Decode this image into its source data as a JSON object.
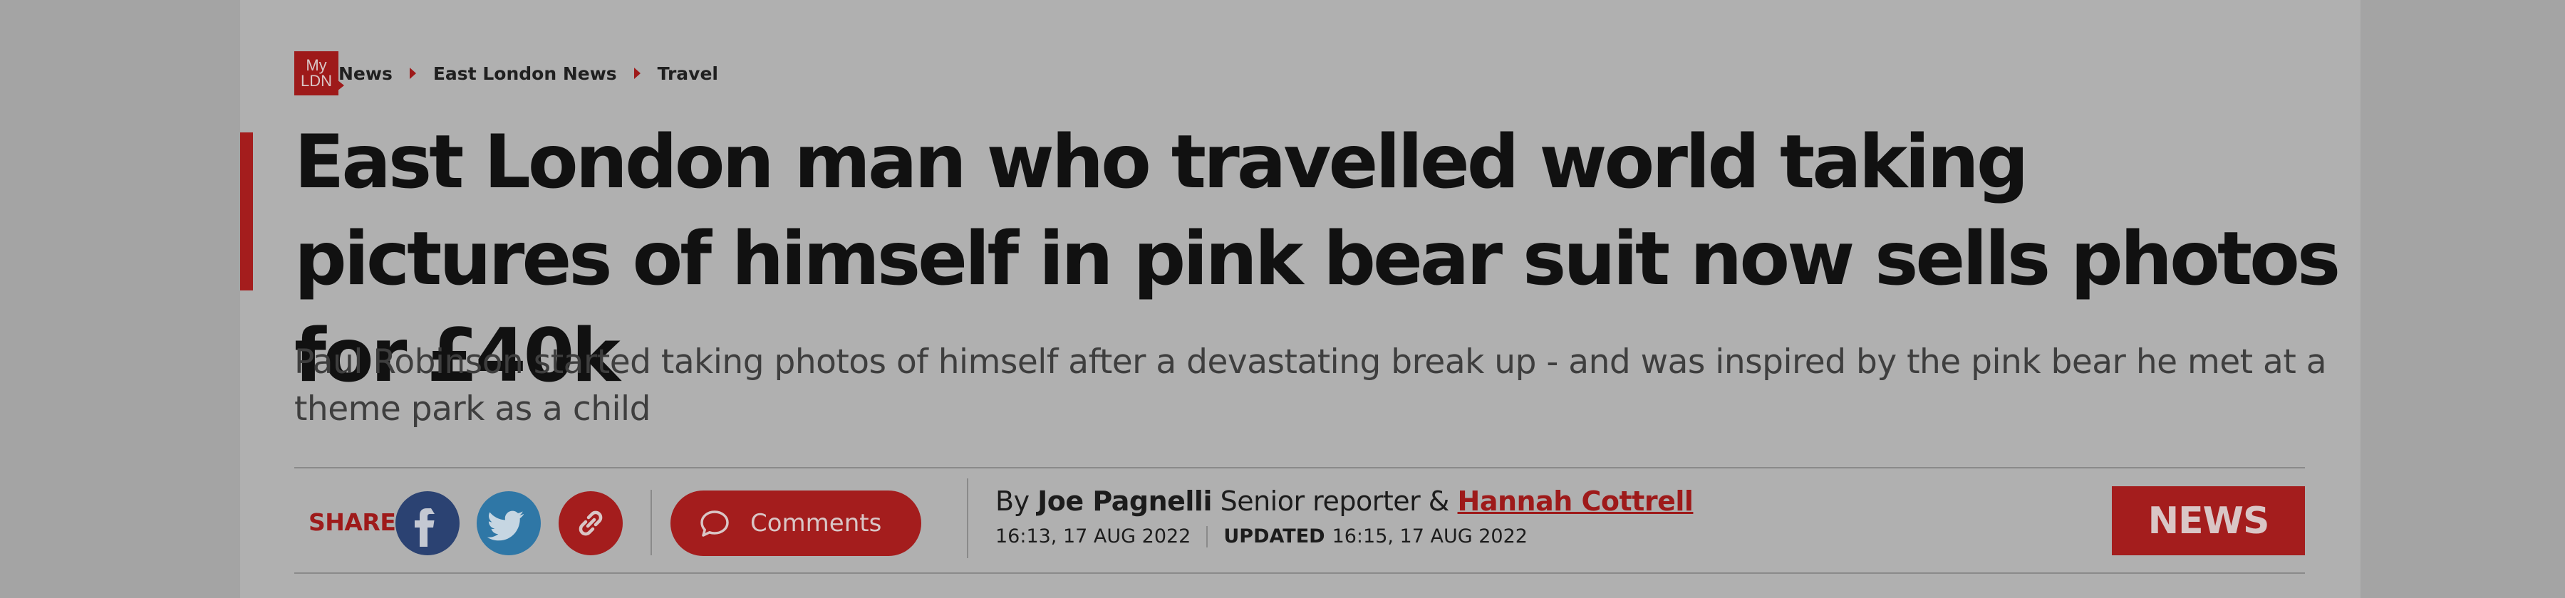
{
  "breadcrumb": {
    "logo_line1": "My",
    "logo_line2": "LDN",
    "items": [
      "News",
      "East London News",
      "Travel"
    ]
  },
  "article": {
    "headline": "East London man who travelled world taking pictures of himself in pink bear suit now sells photos for £40k",
    "standfirst": "Paul Robinson started taking photos of himself after a devastating break up - and was inspired by the pink bear he met at a theme park as a child"
  },
  "share": {
    "label": "SHARE",
    "buttons": [
      {
        "name": "facebook",
        "icon": "facebook-icon",
        "color": "#2b4272"
      },
      {
        "name": "twitter",
        "icon": "twitter-icon",
        "color": "#2f77a6"
      },
      {
        "name": "copy-link",
        "icon": "link-icon",
        "color": "#a41d1d"
      }
    ],
    "comments_label": "Comments"
  },
  "byline": {
    "by": "By",
    "author1": "Joe Pagnelli",
    "role": "Senior reporter &",
    "author2": "Hannah Cottrell",
    "published": "16:13, 17 AUG 2022",
    "updated_label": "UPDATED",
    "updated": "16:15, 17 AUG 2022"
  },
  "section_badge": "NEWS",
  "colors": {
    "accent": "#a41d1d",
    "facebook": "#2b4272",
    "twitter": "#2f77a6"
  }
}
